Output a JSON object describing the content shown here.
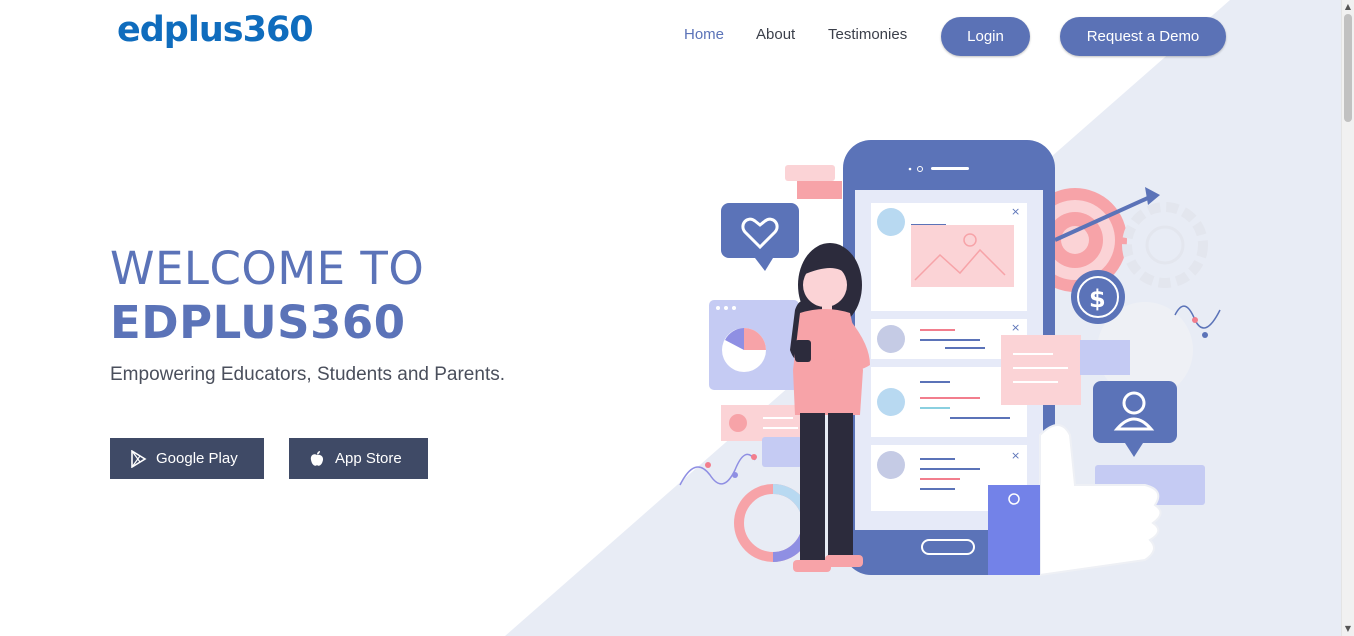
{
  "brand": {
    "logo_text": "edplus360"
  },
  "nav": {
    "links": [
      {
        "label": "Home",
        "active": true
      },
      {
        "label": "About",
        "active": false
      },
      {
        "label": "Testimonies",
        "active": false
      }
    ],
    "login_label": "Login",
    "demo_label": "Request a Demo"
  },
  "hero": {
    "title_line1": "WELCOME TO",
    "title_line2": "EDPLUS360",
    "subtitle": "Empowering Educators, Students and Parents.",
    "google_play_label": "Google Play",
    "app_store_label": "App Store"
  },
  "colors": {
    "accent": "#5b73b8",
    "logo": "#0f6cbd",
    "store_button": "#3f4a66",
    "diagonal_bg": "#e8ecf5"
  },
  "icons": [
    "google-play-icon",
    "apple-icon",
    "heart-icon",
    "dollar-icon",
    "user-icon",
    "close-icon"
  ]
}
